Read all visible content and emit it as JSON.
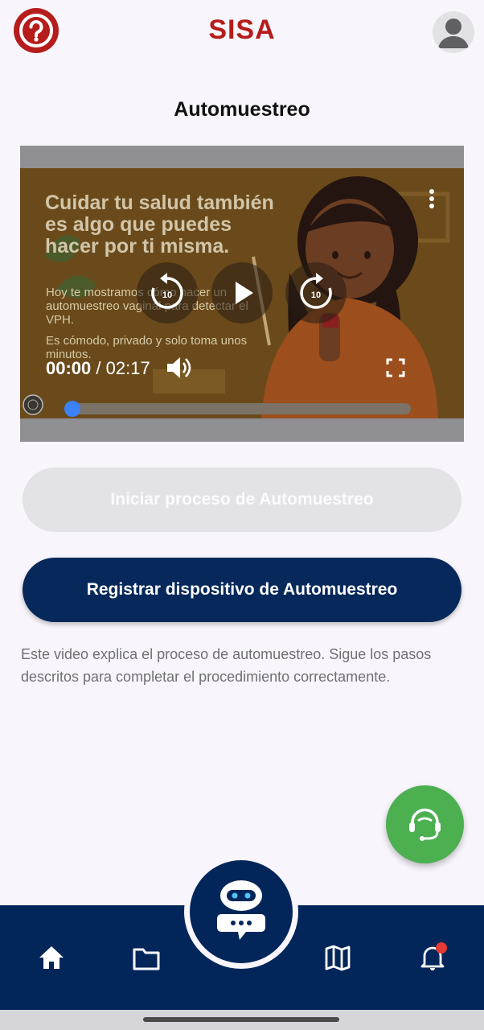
{
  "header": {
    "brand": "SISA",
    "help_icon": "help-circle-icon",
    "profile_icon": "user-avatar-icon"
  },
  "page": {
    "title": "Automuestreo"
  },
  "video": {
    "headline": "Cuidar tu salud también es algo que puedes hacer por ti misma.",
    "subtitle": "Hoy te mostramos cómo hacer un automuestreo vaginal para detectar el VPH.",
    "subtitle2": "Es cómodo, privado y solo toma unos minutos.",
    "current_time": "00:00",
    "separator": " / ",
    "duration": "02:17",
    "progress": 0.0,
    "rewind_seconds": "10",
    "forward_seconds": "10"
  },
  "actions": {
    "start_label": "Iniciar proceso de Automuestreo",
    "register_label": "Registrar dispositivo de Automuestreo"
  },
  "description": "Este video explica el proceso de automuestreo. Sigue los pasos descritos para completar el procedimiento correctamente.",
  "nav": {
    "items": [
      "home-icon",
      "folder-icon",
      "chatbot-icon",
      "map-icon",
      "bell-icon"
    ],
    "notification_dot_color": "#e53935"
  },
  "colors": {
    "brand_red": "#b71c1c",
    "primary_navy": "#06285a",
    "support_green": "#4caf50",
    "progress_blue": "#3b82f6"
  }
}
